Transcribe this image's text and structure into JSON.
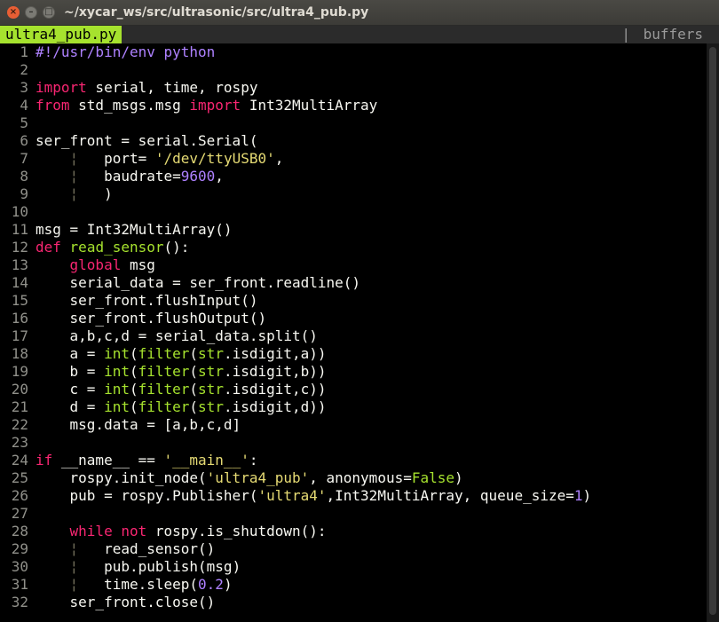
{
  "window": {
    "title": "~/xycar_ws/src/ultrasonic/src/ultra4_pub.py",
    "close_glyph": "×",
    "min_glyph": "–",
    "max_glyph": "□"
  },
  "tabline": {
    "active_tab": "ultra4_pub.py",
    "separator": "|",
    "buffers_label": "buffers"
  },
  "colors": {
    "keyword": "#f92672",
    "string": "#e6db74",
    "number": "#ae81ff",
    "builtin": "#66d9ef",
    "function": "#a6e22e",
    "default": "#f8f8f2",
    "indent_guide": "#75715e",
    "line_number": "#90908a"
  },
  "lines": [
    {
      "n": "1",
      "tokens": [
        {
          "t": "#!/usr/bin/env python",
          "c": "number"
        }
      ]
    },
    {
      "n": "2",
      "tokens": []
    },
    {
      "n": "3",
      "tokens": [
        {
          "t": "import",
          "c": "keyword"
        },
        {
          "t": " serial, time, rospy",
          "c": "default"
        }
      ]
    },
    {
      "n": "4",
      "tokens": [
        {
          "t": "from",
          "c": "keyword"
        },
        {
          "t": " std_msgs.msg ",
          "c": "default"
        },
        {
          "t": "import",
          "c": "keyword"
        },
        {
          "t": " Int32MultiArray",
          "c": "default"
        }
      ]
    },
    {
      "n": "5",
      "tokens": []
    },
    {
      "n": "6",
      "tokens": [
        {
          "t": "ser_front = serial.Serial(",
          "c": "default"
        }
      ]
    },
    {
      "n": "7",
      "tokens": [
        {
          "t": "    ",
          "c": "default"
        },
        {
          "t": "¦",
          "c": "indent_guide"
        },
        {
          "t": "   port= ",
          "c": "default"
        },
        {
          "t": "'/dev/ttyUSB0'",
          "c": "string"
        },
        {
          "t": ",",
          "c": "default"
        }
      ]
    },
    {
      "n": "8",
      "tokens": [
        {
          "t": "    ",
          "c": "default"
        },
        {
          "t": "¦",
          "c": "indent_guide"
        },
        {
          "t": "   baudrate=",
          "c": "default"
        },
        {
          "t": "9600",
          "c": "number"
        },
        {
          "t": ",",
          "c": "default"
        }
      ]
    },
    {
      "n": "9",
      "tokens": [
        {
          "t": "    ",
          "c": "default"
        },
        {
          "t": "¦",
          "c": "indent_guide"
        },
        {
          "t": "   )",
          "c": "default"
        }
      ]
    },
    {
      "n": "10",
      "tokens": []
    },
    {
      "n": "11",
      "tokens": [
        {
          "t": "msg = Int32MultiArray()",
          "c": "default"
        }
      ]
    },
    {
      "n": "12",
      "tokens": [
        {
          "t": "def",
          "c": "keyword"
        },
        {
          "t": " ",
          "c": "default"
        },
        {
          "t": "read_sensor",
          "c": "function"
        },
        {
          "t": "():",
          "c": "default"
        }
      ]
    },
    {
      "n": "13",
      "tokens": [
        {
          "t": "    ",
          "c": "default"
        },
        {
          "t": "global",
          "c": "keyword"
        },
        {
          "t": " msg",
          "c": "default"
        }
      ]
    },
    {
      "n": "14",
      "tokens": [
        {
          "t": "    serial_data = ser_front.readline()",
          "c": "default"
        }
      ]
    },
    {
      "n": "15",
      "tokens": [
        {
          "t": "    ser_front.flushInput()",
          "c": "default"
        }
      ]
    },
    {
      "n": "16",
      "tokens": [
        {
          "t": "    ser_front.flushOutput()",
          "c": "default"
        }
      ]
    },
    {
      "n": "17",
      "tokens": [
        {
          "t": "    a,b,c,d = serial_data.split()",
          "c": "default"
        }
      ]
    },
    {
      "n": "18",
      "tokens": [
        {
          "t": "    a = ",
          "c": "default"
        },
        {
          "t": "int",
          "c": "function"
        },
        {
          "t": "(",
          "c": "default"
        },
        {
          "t": "filter",
          "c": "function"
        },
        {
          "t": "(",
          "c": "default"
        },
        {
          "t": "str",
          "c": "function"
        },
        {
          "t": ".isdigit,a))",
          "c": "default"
        }
      ]
    },
    {
      "n": "19",
      "tokens": [
        {
          "t": "    b = ",
          "c": "default"
        },
        {
          "t": "int",
          "c": "function"
        },
        {
          "t": "(",
          "c": "default"
        },
        {
          "t": "filter",
          "c": "function"
        },
        {
          "t": "(",
          "c": "default"
        },
        {
          "t": "str",
          "c": "function"
        },
        {
          "t": ".isdigit,b))",
          "c": "default"
        }
      ]
    },
    {
      "n": "20",
      "tokens": [
        {
          "t": "    c = ",
          "c": "default"
        },
        {
          "t": "int",
          "c": "function"
        },
        {
          "t": "(",
          "c": "default"
        },
        {
          "t": "filter",
          "c": "function"
        },
        {
          "t": "(",
          "c": "default"
        },
        {
          "t": "str",
          "c": "function"
        },
        {
          "t": ".isdigit,c))",
          "c": "default"
        }
      ]
    },
    {
      "n": "21",
      "tokens": [
        {
          "t": "    d = ",
          "c": "default"
        },
        {
          "t": "int",
          "c": "function"
        },
        {
          "t": "(",
          "c": "default"
        },
        {
          "t": "filter",
          "c": "function"
        },
        {
          "t": "(",
          "c": "default"
        },
        {
          "t": "str",
          "c": "function"
        },
        {
          "t": ".isdigit,d))",
          "c": "default"
        }
      ]
    },
    {
      "n": "22",
      "tokens": [
        {
          "t": "    msg.data = [a,b,c,d]",
          "c": "default"
        }
      ]
    },
    {
      "n": "23",
      "tokens": []
    },
    {
      "n": "24",
      "tokens": [
        {
          "t": "if",
          "c": "keyword"
        },
        {
          "t": " __name__ == ",
          "c": "default"
        },
        {
          "t": "'__main__'",
          "c": "string"
        },
        {
          "t": ":",
          "c": "default"
        }
      ]
    },
    {
      "n": "25",
      "tokens": [
        {
          "t": "    rospy.init_node(",
          "c": "default"
        },
        {
          "t": "'ultra4_pub'",
          "c": "string"
        },
        {
          "t": ", anonymous=",
          "c": "default"
        },
        {
          "t": "False",
          "c": "function"
        },
        {
          "t": ")",
          "c": "default"
        }
      ]
    },
    {
      "n": "26",
      "tokens": [
        {
          "t": "    pub = rospy.Publisher(",
          "c": "default"
        },
        {
          "t": "'ultra4'",
          "c": "string"
        },
        {
          "t": ",Int32MultiArray, queue_size=",
          "c": "default"
        },
        {
          "t": "1",
          "c": "number"
        },
        {
          "t": ")",
          "c": "default"
        }
      ]
    },
    {
      "n": "27",
      "tokens": []
    },
    {
      "n": "28",
      "tokens": [
        {
          "t": "    ",
          "c": "default"
        },
        {
          "t": "while",
          "c": "keyword"
        },
        {
          "t": " ",
          "c": "default"
        },
        {
          "t": "not",
          "c": "keyword"
        },
        {
          "t": " rospy.is_shutdown():",
          "c": "default"
        }
      ]
    },
    {
      "n": "29",
      "tokens": [
        {
          "t": "    ",
          "c": "default"
        },
        {
          "t": "¦",
          "c": "indent_guide"
        },
        {
          "t": "   read_sensor()",
          "c": "default"
        }
      ]
    },
    {
      "n": "30",
      "tokens": [
        {
          "t": "    ",
          "c": "default"
        },
        {
          "t": "¦",
          "c": "indent_guide"
        },
        {
          "t": "   pub.publish(msg)",
          "c": "default"
        }
      ]
    },
    {
      "n": "31",
      "tokens": [
        {
          "t": "    ",
          "c": "default"
        },
        {
          "t": "¦",
          "c": "indent_guide"
        },
        {
          "t": "   time.sleep(",
          "c": "default"
        },
        {
          "t": "0.2",
          "c": "number"
        },
        {
          "t": ")",
          "c": "default"
        }
      ]
    },
    {
      "n": "32",
      "tokens": [
        {
          "t": "    ser_front.close()",
          "c": "default"
        }
      ]
    }
  ]
}
